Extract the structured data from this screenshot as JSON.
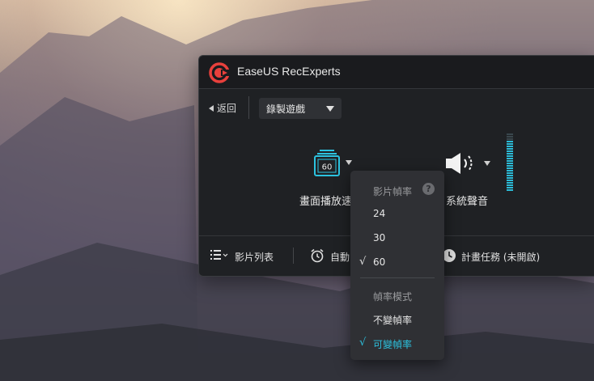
{
  "app": {
    "title": "EaseUS RecExperts"
  },
  "toolbar": {
    "back_label": "返回",
    "mode_value": "錄製遊戲"
  },
  "sources": {
    "fps_value": "60",
    "fps_label": "畫面播放速",
    "system_audio_label": "系統聲音"
  },
  "bottom": {
    "video_list_label": "影片列表",
    "auto_label": "自動",
    "schedule_label": "計畫任務 (未開啟)"
  },
  "fps_menu": {
    "header": "影片幀率",
    "help": "?",
    "options": [
      {
        "label": "24",
        "selected": false
      },
      {
        "label": "30",
        "selected": false
      },
      {
        "label": "60",
        "selected": true
      }
    ],
    "mode_header": "幀率模式",
    "modes": [
      {
        "label": "不變幀率",
        "selected": false
      },
      {
        "label": "可變幀率",
        "selected": true
      }
    ],
    "check": "√"
  },
  "colors": {
    "accent": "#2cc3e0",
    "window_bg": "#1f2124",
    "menu_bg": "#2f3034",
    "logo_red": "#e8403c"
  },
  "icons": [
    "easeus-logo-icon",
    "back-arrow-icon",
    "dropdown-caret-icon",
    "fps-monitor-icon",
    "speaker-icon",
    "volume-meter",
    "list-icon",
    "alarm-clock-icon",
    "clock-icon",
    "help-icon",
    "check-icon"
  ]
}
